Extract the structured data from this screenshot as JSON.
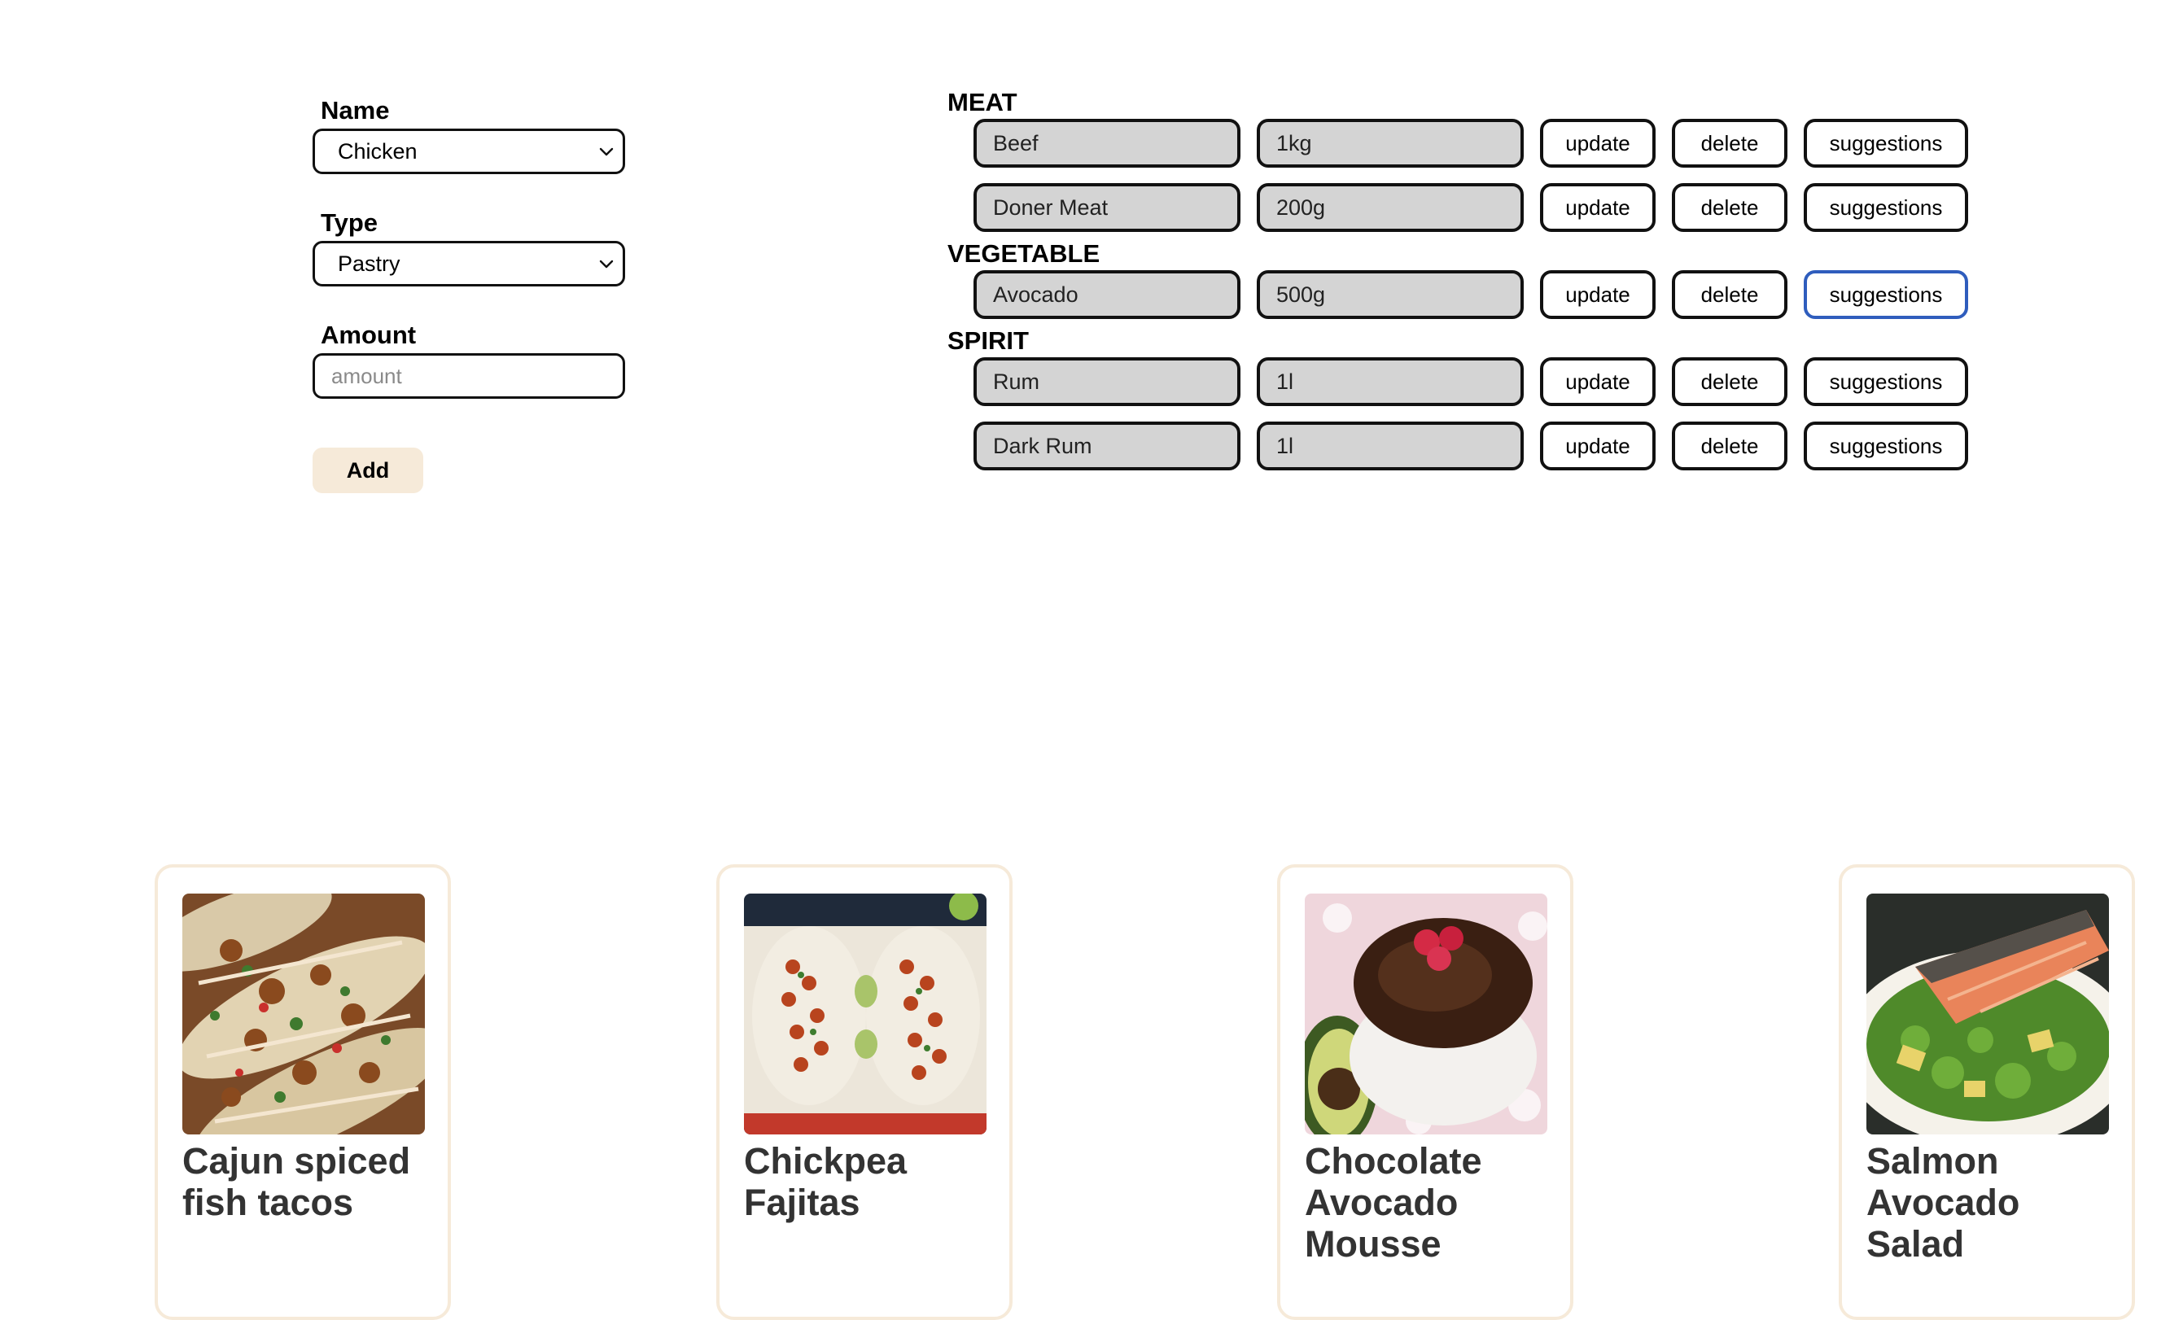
{
  "form": {
    "name_label": "Name",
    "name_value": "Chicken",
    "type_label": "Type",
    "type_value": "Pastry",
    "amount_label": "Amount",
    "amount_placeholder": "amount",
    "add_label": "Add"
  },
  "ingredients": {
    "categories": [
      {
        "heading": "MEAT",
        "items": [
          {
            "name": "Beef",
            "amount": "1kg"
          },
          {
            "name": "Doner Meat",
            "amount": "200g"
          }
        ]
      },
      {
        "heading": "VEGETABLE",
        "items": [
          {
            "name": "Avocado",
            "amount": "500g"
          }
        ]
      },
      {
        "heading": "SPIRIT",
        "items": [
          {
            "name": "Rum",
            "amount": "1l"
          },
          {
            "name": "Dark Rum",
            "amount": "1l"
          }
        ]
      }
    ],
    "update_label": "update",
    "delete_label": "delete",
    "suggestions_label": "suggestions"
  },
  "recipes": [
    {
      "title": "Cajun spiced fish tacos"
    },
    {
      "title": "Chickpea Fajitas"
    },
    {
      "title": "Chocolate Avocado Mousse"
    },
    {
      "title": "Salmon Avocado Salad"
    }
  ],
  "colors": {
    "add_button_bg": "#f6ead9",
    "card_border": "#f6ead9",
    "field_bg": "#d4d4d4",
    "focus_ring": "#2f5dbd"
  }
}
